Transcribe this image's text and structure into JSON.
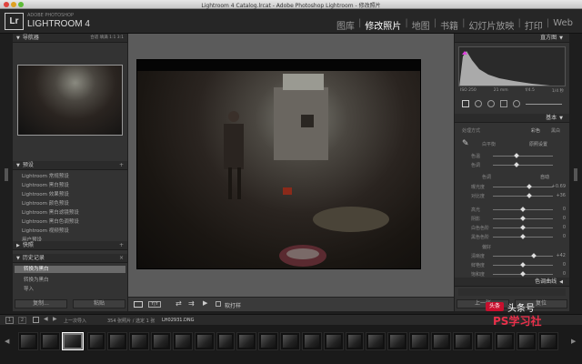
{
  "window": {
    "title": "Lightroom 4 Catalog.lrcat - Adobe Photoshop Lightroom - 修改照片"
  },
  "brand": {
    "logo": "Lr",
    "sub": "ADOBE PHOTOSHOP",
    "name": "LIGHTROOM 4"
  },
  "modules": [
    {
      "label": "图库",
      "active": false
    },
    {
      "label": "修改照片",
      "active": true
    },
    {
      "label": "地图",
      "active": false
    },
    {
      "label": "书籍",
      "active": false
    },
    {
      "label": "幻灯片放映",
      "active": false
    },
    {
      "label": "打印",
      "active": false
    },
    {
      "label": "Web",
      "active": false
    }
  ],
  "left": {
    "navigator": {
      "title": "导航器",
      "options": "合适 填满 1:1 3:1"
    },
    "presets": {
      "title": "预设",
      "items": [
        "Lightroom 常规预设",
        "Lightroom 黑白预设",
        "Lightroom 效果预设",
        "Lightroom 颜色预设",
        "Lightroom 黑白滤镜预设",
        "Lightroom 黑白色调预设",
        "Lightroom 视频预设",
        "用户预设"
      ]
    },
    "snapshots": {
      "title": "快照"
    },
    "history": {
      "title": "历史记录",
      "items": [
        "转换为黑白",
        "转换为黑白",
        "导入"
      ]
    },
    "copy_button": "复制...",
    "paste_button": "粘贴"
  },
  "right": {
    "histogram": {
      "title": "直方图",
      "readout": [
        "ISO 250",
        "21 mm",
        "f/4.5",
        "1/4 秒"
      ]
    },
    "basic": {
      "title": "基本",
      "treatment_label": "处理方式",
      "treatments": [
        "彩色",
        "黑白"
      ],
      "wb_label": "白平衡",
      "wb_value": "原照设置",
      "tone_label": "色调",
      "auto_label": "自动",
      "presence_label": "偏好"
    },
    "sliders": [
      {
        "label": "色温",
        "value": ""
      },
      {
        "label": "色调",
        "value": ""
      },
      {
        "label": "曝光度",
        "value": "+0.69"
      },
      {
        "label": "对比度",
        "value": "+36"
      },
      {
        "label": "高光",
        "value": "0"
      },
      {
        "label": "阴影",
        "value": "0"
      },
      {
        "label": "白色色阶",
        "value": "0"
      },
      {
        "label": "黑色色阶",
        "value": "0"
      },
      {
        "label": "清晰度",
        "value": "+42"
      },
      {
        "label": "鲜艳度",
        "value": "0"
      },
      {
        "label": "饱和度",
        "value": "0"
      }
    ],
    "tone_curve": {
      "title": "色调曲线"
    },
    "prev_button": "上一张",
    "reset_button": "复位"
  },
  "toolbar": {
    "softproof": "软打样"
  },
  "filmstrip": {
    "page1": "1",
    "page2": "2",
    "path": "上一次导入",
    "count": "354 张照片 / 选定 1 张",
    "file": "LH02931.DNG"
  },
  "watermark": {
    "badge": "头条",
    "line1": "头条号",
    "line2": "PS学习社"
  },
  "colors": {
    "accent": "#ffffff",
    "panel": "#333333",
    "brand_red": "#c8102e"
  }
}
